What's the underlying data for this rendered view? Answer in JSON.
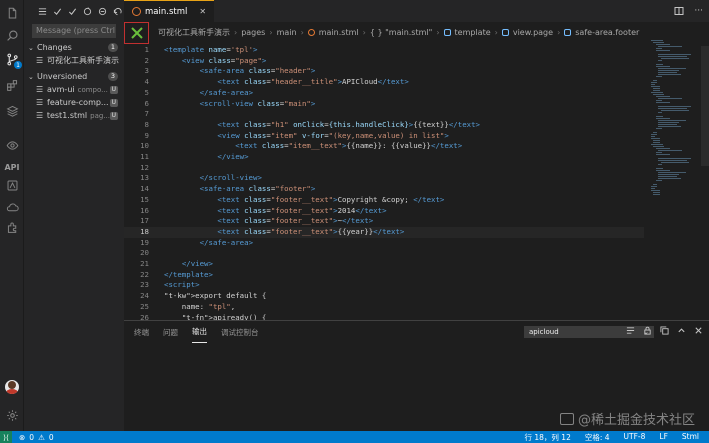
{
  "activity_bar": {
    "items": [
      "files-icon",
      "search-icon",
      "source-control-icon",
      "extensions-icon",
      "layers-icon",
      "preview-icon",
      "API",
      "apicloud-icon",
      "cloud-icon",
      "plugin-icon"
    ],
    "api_label": "API",
    "scm_badge": "1"
  },
  "sidebar": {
    "commit_placeholder": "Message (press Ctrl+Enter to commit)",
    "changes": {
      "label": "Changes",
      "count": "1",
      "files": [
        {
          "name": "可视化工具新手演示",
          "desc": "",
          "badge": ""
        }
      ]
    },
    "unversioned": {
      "label": "Unversioned",
      "count": "3",
      "files": [
        {
          "name": "avm-ui",
          "desc": "compo...",
          "badge": "U"
        },
        {
          "name": "feature-comp...",
          "desc": "",
          "badge": "U"
        },
        {
          "name": "test1.stml",
          "desc": "pag...",
          "badge": "U"
        }
      ]
    }
  },
  "tab": {
    "label": "main.stml"
  },
  "breadcrumbs": [
    "可视化工具新手演示",
    "pages",
    "main",
    "main.stml",
    "{ } \"main.stml\"",
    "template",
    "view.page",
    "safe-area.footer"
  ],
  "code_lines": [
    {
      "n": "1",
      "t": "<template name='tpl'>"
    },
    {
      "n": "2",
      "t": "    <view class=\"page\">"
    },
    {
      "n": "3",
      "t": "        <safe-area class=\"header\">"
    },
    {
      "n": "4",
      "t": "            <text class=\"header__title\">APICloud</text>"
    },
    {
      "n": "5",
      "t": "        </safe-area>"
    },
    {
      "n": "6",
      "t": "        <scroll-view class=\"main\">"
    },
    {
      "n": "7",
      "t": ""
    },
    {
      "n": "8",
      "t": "            <text class=\"h1\" onClick={this.handleClick}>{{text}}</text>"
    },
    {
      "n": "9",
      "t": "            <view class=\"item\" v-for=\"(key,name,value) in list\">"
    },
    {
      "n": "10",
      "t": "                <text class=\"item__text\">{{name}}: {{value}}</text>"
    },
    {
      "n": "11",
      "t": "            </view>"
    },
    {
      "n": "12",
      "t": ""
    },
    {
      "n": "13",
      "t": "        </scroll-view>"
    },
    {
      "n": "14",
      "t": "        <safe-area class=\"footer\">"
    },
    {
      "n": "15",
      "t": "            <text class=\"footer__text\">Copyright &copy; </text>"
    },
    {
      "n": "16",
      "t": "            <text class=\"footer__text\">2014</text>"
    },
    {
      "n": "17",
      "t": "            <text class=\"footer__text\">~</text>"
    },
    {
      "n": "18",
      "t": "            <text class=\"footer__text\">{{year}}</text>"
    },
    {
      "n": "19",
      "t": "        </safe-area>"
    },
    {
      "n": "20",
      "t": ""
    },
    {
      "n": "21",
      "t": "    </view>"
    },
    {
      "n": "22",
      "t": "</template>"
    },
    {
      "n": "23",
      "t": "<script>"
    },
    {
      "n": "24",
      "t": "export default {"
    },
    {
      "n": "25",
      "t": "    name: \"tpl\","
    },
    {
      "n": "26",
      "t": "    apiready() {"
    }
  ],
  "current_line": "18",
  "panel": {
    "tabs": [
      "终端",
      "问题",
      "输出",
      "调试控制台"
    ],
    "active_tab": "输出",
    "output_channel": "apicloud"
  },
  "status": {
    "errors": "0",
    "warnings": "0",
    "position": "行 18，列 12",
    "indent": "空格: 4",
    "encoding": "UTF-8",
    "eol": "LF",
    "language": "Stml"
  },
  "watermark": "@稀土掘金技术社区",
  "colors": {
    "accent": "#007acc",
    "tab_border": "#e8a317",
    "html_icon": "#e37933"
  }
}
